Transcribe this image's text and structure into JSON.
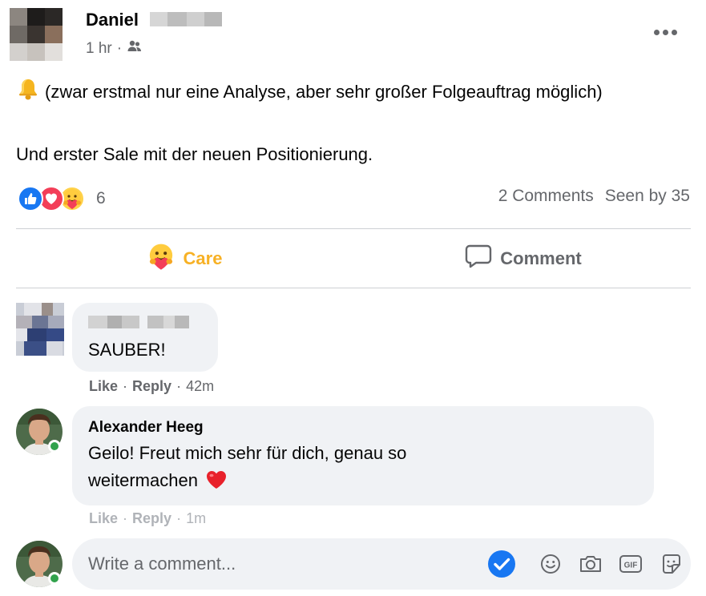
{
  "post": {
    "author_name": "Daniel",
    "time": "1 hr",
    "separator": "·",
    "text_line1": "(zwar erstmal nur eine Analyse, aber sehr großer Folgeauftrag möglich)",
    "text_line2": "Und erster Sale mit der neuen Positionierung.",
    "icons": {
      "audience": "friends-icon",
      "emoji": "bell-icon",
      "more": "more-options-icon"
    }
  },
  "reactions": {
    "count": "6",
    "types": [
      "like",
      "love",
      "care"
    ],
    "comments_count": "2 Comments",
    "seen_by": "Seen by 35"
  },
  "actions": {
    "care_label": "Care",
    "comment_label": "Comment"
  },
  "comments": [
    {
      "author": "",
      "text": "SAUBER!",
      "like": "Like",
      "reply": "Reply",
      "time": "42m"
    },
    {
      "author": "Alexander Heeg",
      "text": "Geilo! Freut mich sehr für dich, genau so weitermachen",
      "like": "Like",
      "reply": "Reply",
      "time": "1m"
    }
  ],
  "composer": {
    "placeholder": "Write a comment...",
    "tools": [
      "checkmark-icon",
      "emoji-icon",
      "camera-icon",
      "gif-icon",
      "sticker-icon"
    ],
    "gif_label": "GIF"
  },
  "colors": {
    "care": "#f7b125",
    "like_blue": "#1877f2",
    "love_red": "#f33e58",
    "muted": "#65676b",
    "bubble": "#f0f2f5",
    "online": "#31a24c"
  }
}
